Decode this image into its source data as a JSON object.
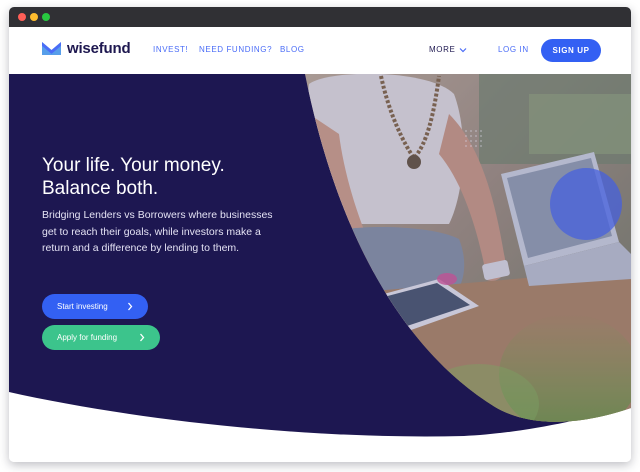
{
  "colors": {
    "brand_navy": "#1e1850",
    "link_blue": "#4a6cf7",
    "primary_blue": "#3360f3",
    "funding_green": "#3cc48c",
    "hero_background": "#1d1751"
  },
  "navbar": {
    "logo_text": "wisefund",
    "links": [
      "INVEST!",
      "NEED FUNDING?",
      "BLOG"
    ],
    "more_label": "MORE",
    "login_label": "LOG IN",
    "signup_label": "SIGN UP"
  },
  "hero": {
    "headline_line1": "Your life. Your money.",
    "headline_line2": "Balance both.",
    "subtext": "Bridging Lenders vs Borrowers where businesses get to reach their goals, while investors make a return and a difference by lending to them.",
    "invest_button": "Start investing",
    "funding_button": "Apply for funding",
    "photo_subject": "woman using a tablet at a wooden desk with a laptop"
  },
  "icons": {
    "logo": "wisefund-logo-icon",
    "more": "chevron-down-icon",
    "button_arrow": "chevron-right-icon"
  }
}
